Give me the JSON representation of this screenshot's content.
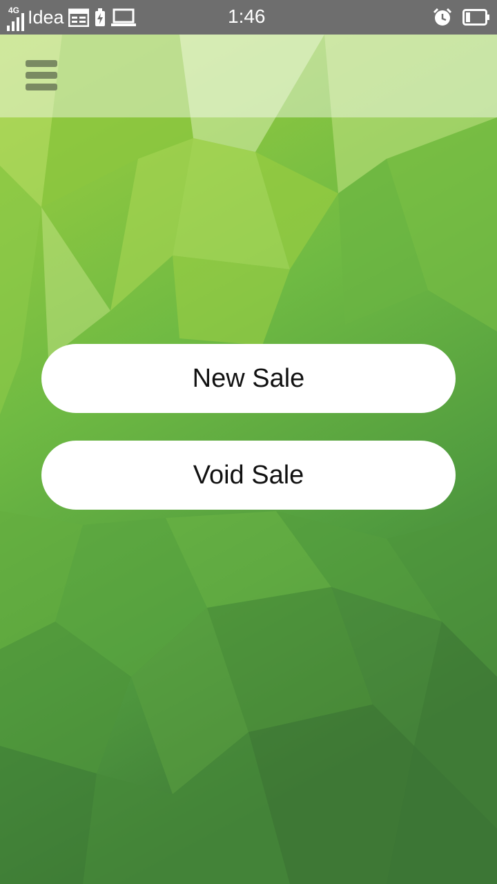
{
  "status_bar": {
    "network_type": "4G",
    "carrier": "Idea",
    "time": "1:46",
    "icons": [
      "signal-icon",
      "calendar-icon",
      "battery-saver-icon",
      "laptop-icon",
      "alarm-icon",
      "battery-icon"
    ]
  },
  "colors": {
    "status_bar_bg": "#6e6e6e",
    "background_light": "#9ccb3c",
    "background_dark": "#3e7a36",
    "menu_icon": "#7a8a62",
    "button_bg": "#ffffff",
    "button_text": "#111111"
  },
  "menu": {
    "icon": "hamburger-menu-icon"
  },
  "actions": {
    "new_sale_label": "New Sale",
    "void_sale_label": "Void Sale"
  }
}
